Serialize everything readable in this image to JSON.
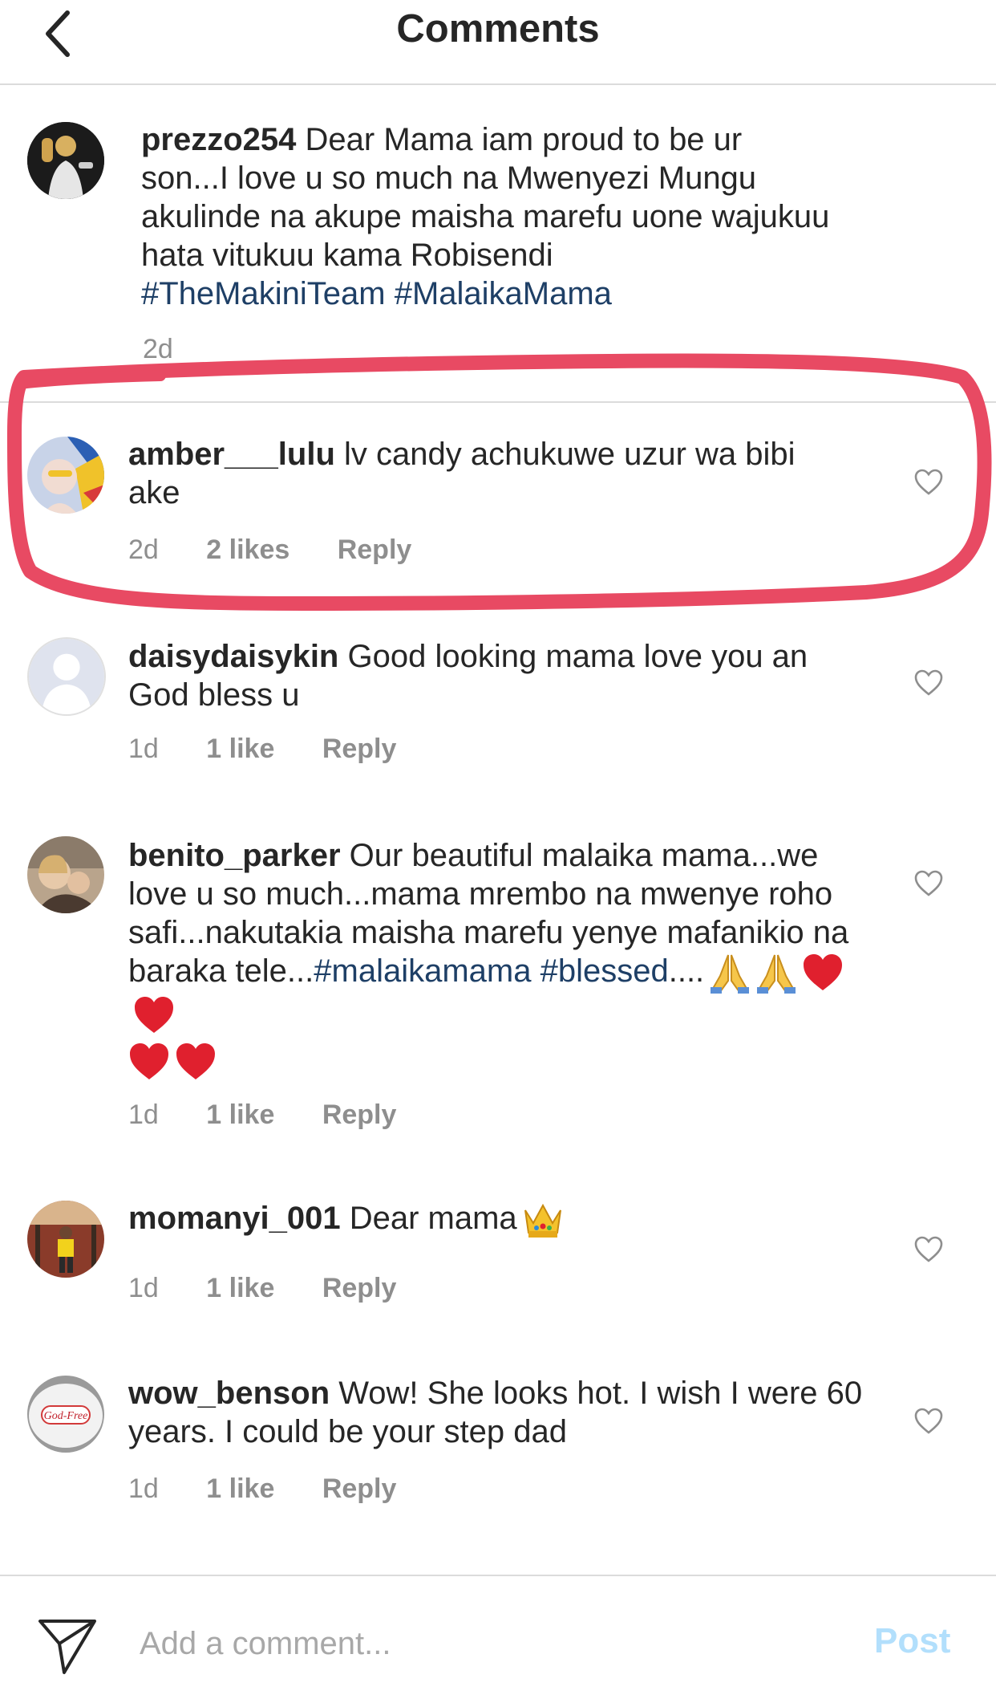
{
  "header": {
    "title": "Comments"
  },
  "caption": {
    "username": "prezzo254",
    "text": "Dear Mama iam proud to be ur son...I love u so much na Mwenyezi Mungu akulinde na akupe maisha marefu uone wajukuu hata vitukuu kama Robisendi",
    "hashtags": [
      "#TheMakiniTeam",
      "#MalaikaMama"
    ],
    "time": "2d"
  },
  "comments": [
    {
      "username": "amber___lulu",
      "text": "lv candy achukuwe uzur wa bibi ake",
      "time": "2d",
      "likes": "2 likes",
      "reply": "Reply",
      "highlighted": true
    },
    {
      "username": "daisydaisykin",
      "text": "Good looking mama love you an God bless u",
      "time": "1d",
      "likes": "1 like",
      "reply": "Reply"
    },
    {
      "username": "benito_parker",
      "text_a": "Our beautiful malaika mama...we love u so much...mama mrembo na mwenye roho safi...nakutakia maisha marefu yenye mafanikio na baraka tele...",
      "hashtag_1": "#malaikamama",
      "hashtag_2": "#blessed",
      "text_b": "....",
      "emojis": [
        "folded-hands",
        "folded-hands",
        "red-heart",
        "red-heart",
        "red-heart",
        "red-heart"
      ],
      "time": "1d",
      "likes": "1 like",
      "reply": "Reply"
    },
    {
      "username": "momanyi_001",
      "text": "Dear mama",
      "emojis": [
        "crown"
      ],
      "time": "1d",
      "likes": "1 like",
      "reply": "Reply"
    },
    {
      "username": "wow_benson",
      "text": "Wow! She looks hot. I wish I were 60 years. I could be your step dad",
      "avatar_text": "God-Free",
      "time": "1d",
      "likes": "1 like",
      "reply": "Reply"
    }
  ],
  "footer": {
    "placeholder": "Add a comment...",
    "post_label": "Post"
  },
  "colors": {
    "hashtag": "#1e3f66",
    "meta": "#8e8e8e",
    "post_disabled": "#b2dffc",
    "annotation_stroke": "#e84a63"
  }
}
